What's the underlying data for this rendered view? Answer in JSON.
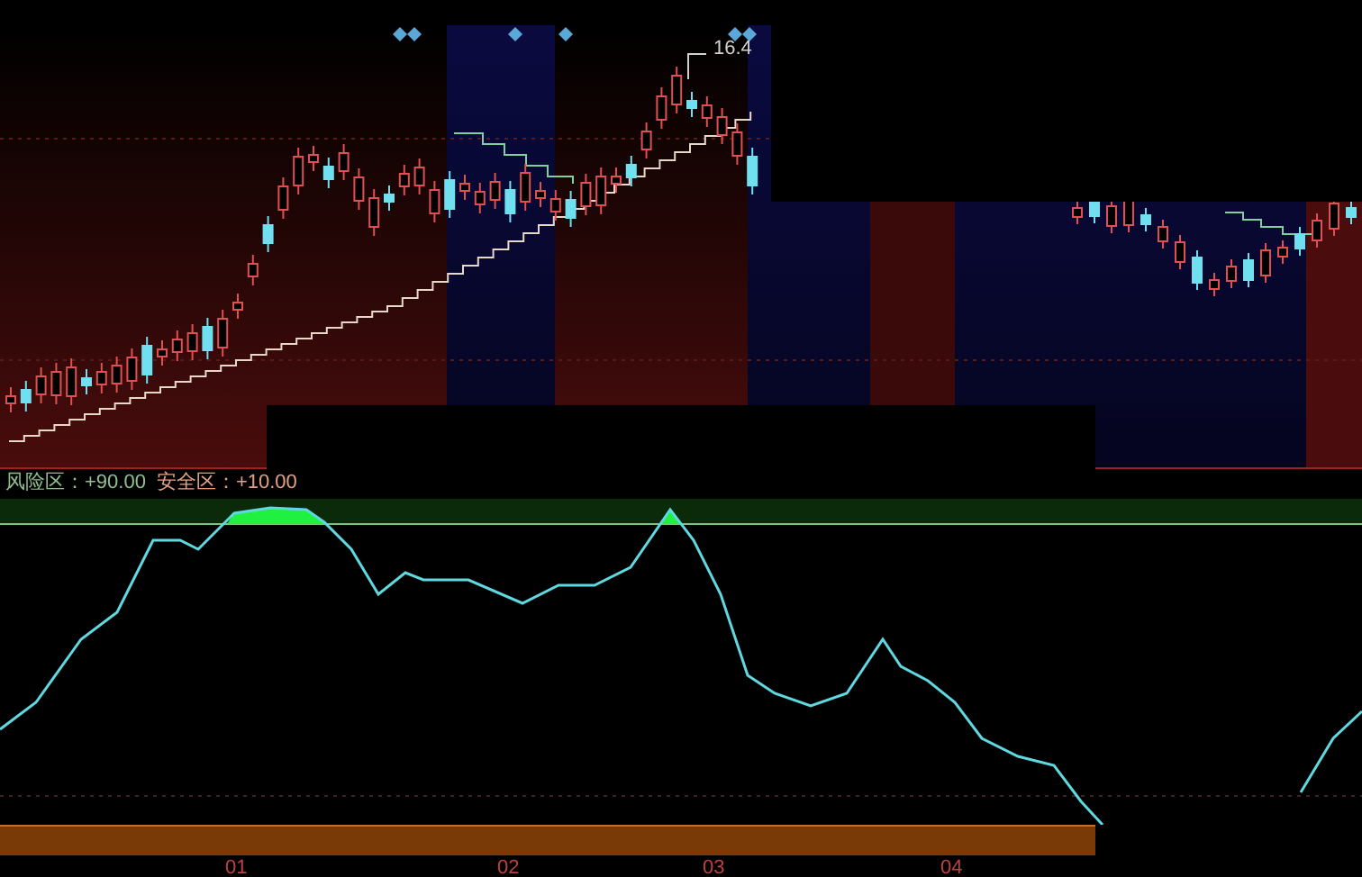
{
  "price_chart": {
    "price_label": "16.4"
  },
  "indicator": {
    "legend": [
      {
        "text": "风险区：+90.00",
        "color": "#8fbf8f"
      },
      {
        "text": "安全区：+10.00",
        "color": "#e0a080"
      }
    ]
  },
  "x_axis": {
    "labels": [
      "01",
      "02",
      "03",
      "04"
    ]
  }
}
